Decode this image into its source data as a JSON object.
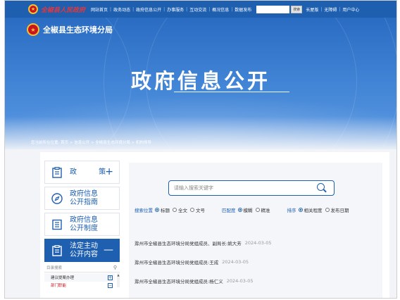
{
  "topbar": {
    "site_name": "全椒县人民政府",
    "nav": [
      "网站首页",
      "政务动态",
      "政府信息公开",
      "办事服务",
      "互动交流",
      "概况信息",
      "数据发布"
    ],
    "search_button": "搜索",
    "utilities": [
      "长屋版",
      "无障碍",
      "用户中心"
    ]
  },
  "hero": {
    "bureau_name": "全椒县生态环境分局",
    "title": "政府信息公开",
    "breadcrumb": "您当前所在位置:  首页 > 信息公开 > 全椒县生态环境分局 > 机构领导"
  },
  "sidebar": {
    "items": [
      {
        "label": "政  策",
        "icon": "clipboard-icon",
        "toggle": "+"
      },
      {
        "label": "政府信息\n公开指南",
        "icon": "compass-icon"
      },
      {
        "label": "政府信息\n公开制度",
        "icon": "document-list-icon"
      },
      {
        "label": "法定主动\n公开内容",
        "icon": "clipboard-icon",
        "toggle": "—"
      }
    ],
    "directory": {
      "search_placeholder": "目录搜索",
      "rows": [
        {
          "label": "建议提案办理",
          "toggle": "+"
        },
        {
          "label": "部门职能",
          "toggle": "−"
        }
      ]
    }
  },
  "main": {
    "search_placeholder": "请输入搜索关键字",
    "filters": {
      "position_label": "搜索位置",
      "position_options": [
        "标题",
        "全文",
        "文号"
      ],
      "match_label": "匹配度",
      "match_options": [
        "模糊",
        "精准"
      ],
      "sort_label": "排序",
      "sort_options": [
        "相关程度",
        "发布日期"
      ]
    },
    "results": [
      {
        "title": "滁州市全椒县生态环境分局党组成员、副局长:姚大芳",
        "date": "2024-03-05"
      },
      {
        "title": "滁州市全椒县生态环境分局党组成员:王成",
        "date": "2024-03-05"
      },
      {
        "title": "滁州市全椒县生态环境分局党组成员:杨仁义",
        "date": "2024-03-05"
      }
    ]
  },
  "colors": {
    "brand_blue": "#1e5fb0",
    "emblem_red": "#c8141e",
    "emblem_gold": "#f2c230"
  }
}
